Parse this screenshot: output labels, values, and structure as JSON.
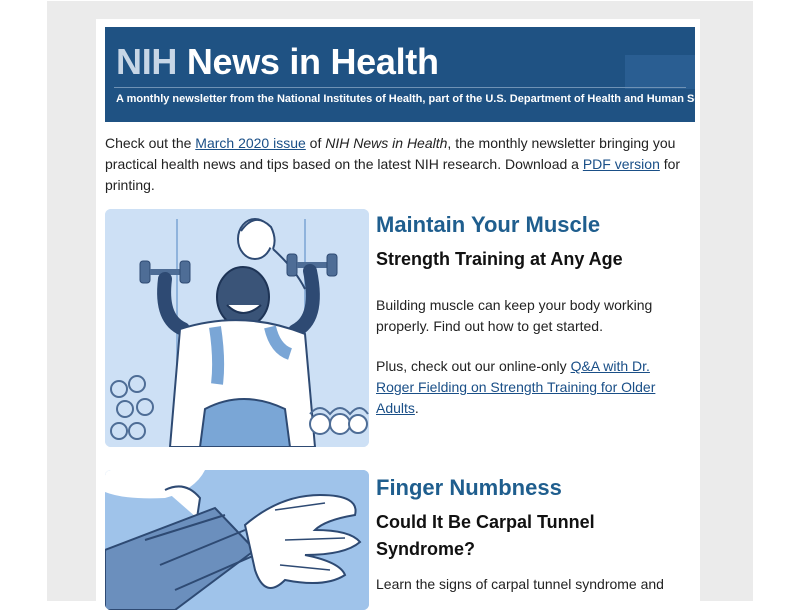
{
  "header": {
    "brand_nih": "NIH",
    "brand_rest": "News in Health",
    "tagline": "A monthly newsletter from the National Institutes of Health, part of the U.S. Department of Health and Human Services"
  },
  "intro": {
    "text_before": "Check out the ",
    "issue_link": "March 2020 issue",
    "text_of": " of ",
    "publication": "NIH News in Health",
    "text_middle": ", the monthly newsletter bringing you practical health news and tips based on the latest NIH research. Download a ",
    "pdf_link": "PDF version",
    "text_after": " for printing."
  },
  "articles": [
    {
      "title": "Maintain Your Muscle",
      "subtitle": "Strength Training at Any Age",
      "summary": "Building muscle can keep your body working properly. Find out how to get started.",
      "extra_before": "Plus, check out our online-only ",
      "extra_link": "Q&A with Dr. Roger Fielding on Strength Training for Older Adults",
      "extra_after": "."
    },
    {
      "title": "Finger Numbness",
      "subtitle": "Could It Be Carpal Tunnel Syndrome?",
      "summary": "Learn the signs of carpal tunnel syndrome and"
    }
  ],
  "colors": {
    "banner": "#1f5283",
    "title": "#1f5e8e",
    "link": "#1a4f87",
    "background": "#ebebeb"
  }
}
